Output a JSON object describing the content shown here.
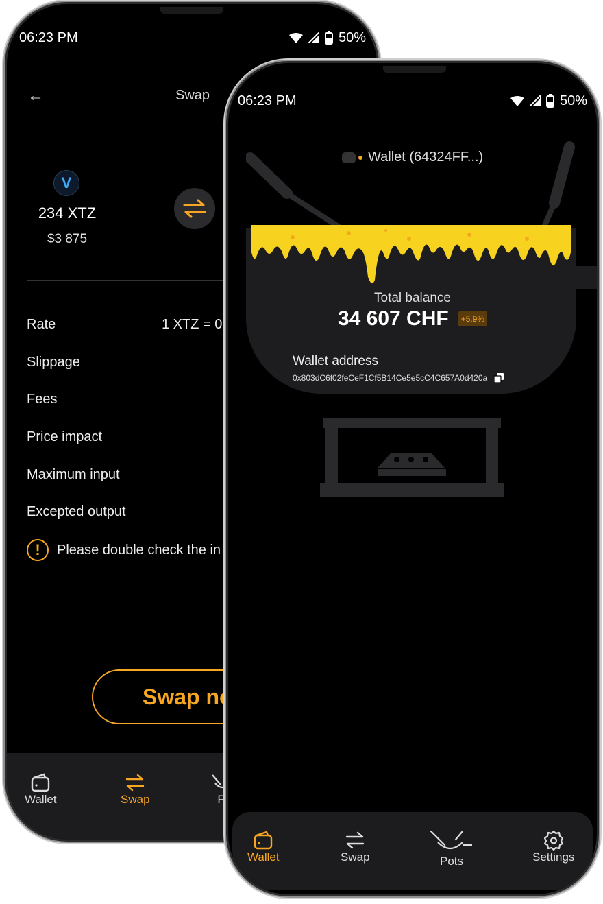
{
  "status_bar": {
    "time": "06:23 PM",
    "battery": "50%"
  },
  "swap_screen": {
    "title": "Swap",
    "from_token": {
      "amount": "234 XTZ",
      "usd": "$3 875"
    },
    "details": [
      {
        "label": "Rate",
        "value": "1 XTZ = 0"
      },
      {
        "label": "Slippage",
        "value": ""
      },
      {
        "label": "Fees",
        "value": ""
      },
      {
        "label": "Price impact",
        "value": ""
      },
      {
        "label": "Maximum input",
        "value": ""
      },
      {
        "label": "Excepted output",
        "value": ""
      }
    ],
    "warning": "Please double check the in",
    "swap_button": "Swap no",
    "nav": {
      "wallet": "Wallet",
      "swap": "Swap",
      "pots": "P"
    }
  },
  "wallet_screen": {
    "wallet_name": "Wallet (64324FF...)",
    "total_balance_label": "Total balance",
    "total_balance": "34 607 CHF",
    "change_badge": "+5.9%",
    "wallet_address_label": "Wallet address",
    "wallet_address": "0x803dC6f02feCeF1Cf5B14Ce5e5cC4C657A0d420a",
    "nav": {
      "wallet": "Wallet",
      "swap": "Swap",
      "pots": "Pots",
      "settings": "Settings"
    }
  },
  "colors": {
    "accent": "#f6a623",
    "background": "#000000",
    "surface": "#1c1c1e",
    "cheese": "#f7d21e"
  }
}
